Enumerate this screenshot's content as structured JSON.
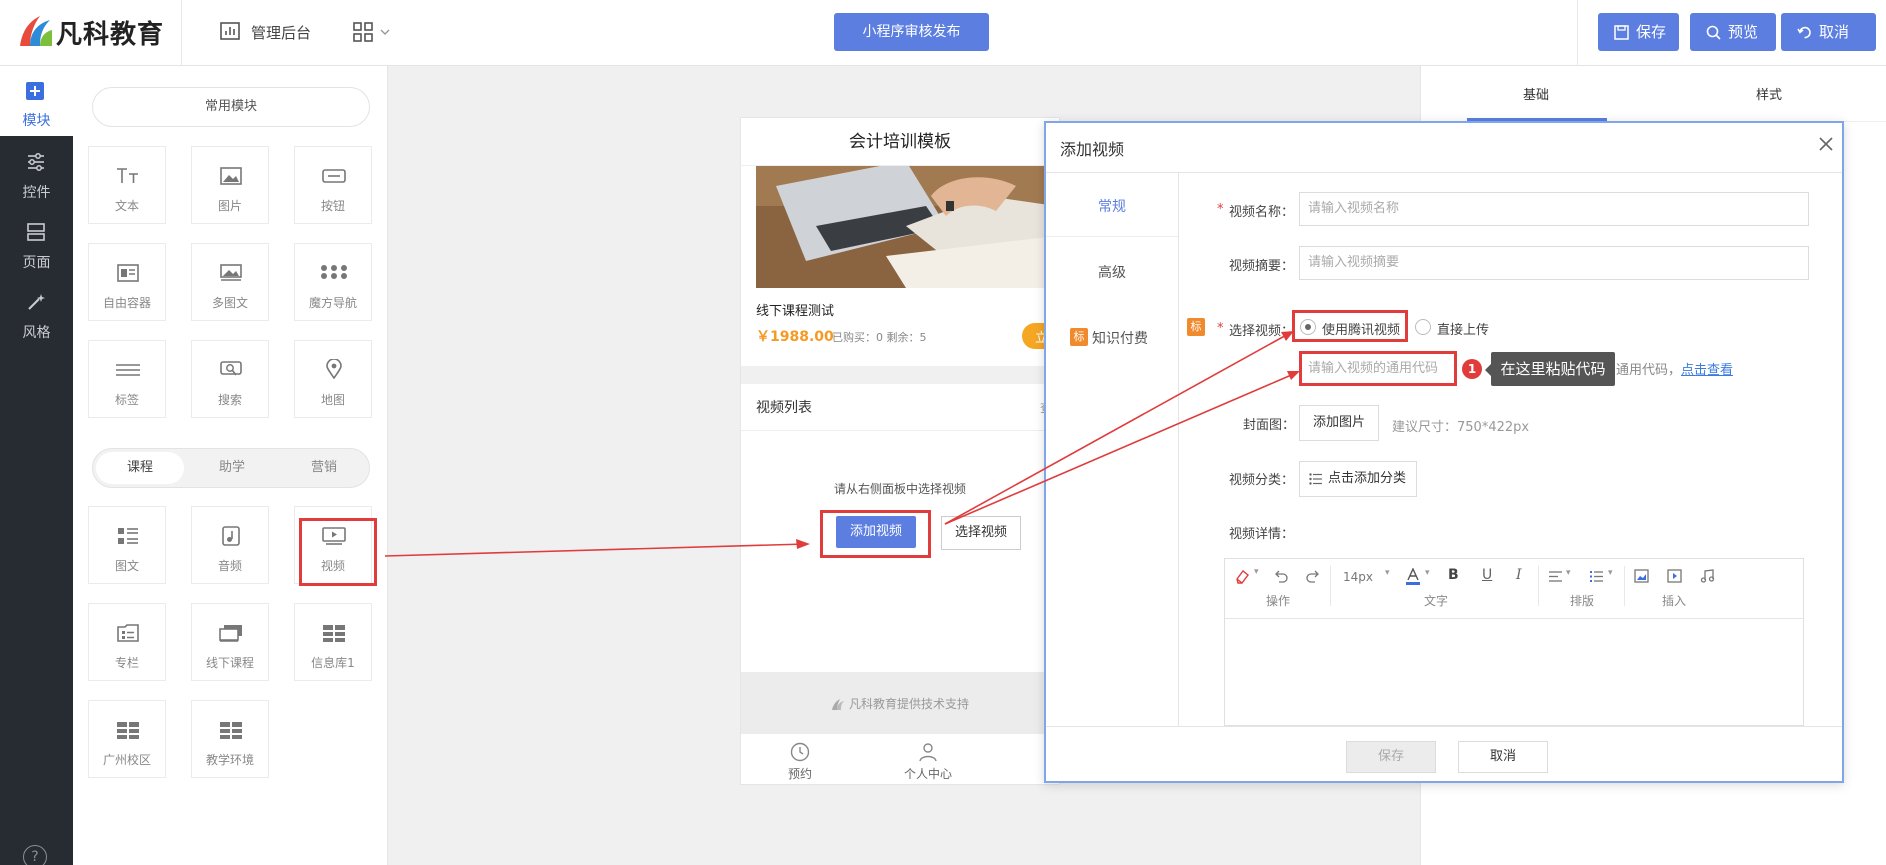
{
  "header": {
    "logo_text": "凡科教育",
    "admin_label": "管理后台",
    "publish_label": "小程序审核发布",
    "save_label": "保存",
    "preview_label": "预览",
    "cancel_label": "取消"
  },
  "rail": {
    "items": [
      {
        "label": "模块",
        "icon": "plus-square-icon"
      },
      {
        "label": "控件",
        "icon": "sliders-icon"
      },
      {
        "label": "页面",
        "icon": "pages-icon"
      },
      {
        "label": "风格",
        "icon": "magic-wand-icon"
      }
    ],
    "help": "?"
  },
  "left_panel": {
    "common_title": "常用模块",
    "common_modules": [
      "文本",
      "图片",
      "按钮",
      "自由容器",
      "多图文",
      "魔方导航",
      "标签",
      "搜索",
      "地图"
    ],
    "category_tabs": [
      "课程",
      "助学",
      "营销"
    ],
    "course_modules": [
      "图文",
      "音频",
      "视频",
      "专栏",
      "线下课程",
      "信息库1",
      "广州校区",
      "教学环境"
    ]
  },
  "phone": {
    "title": "会计培训模板",
    "course_name": "线下课程测试",
    "course_price": "￥1988.00",
    "course_meta": "已购买：0 剩余：5",
    "buy_label": "立",
    "video_list_title": "视频列表",
    "video_list_more": "查",
    "empty_hint": "请从右侧面板中选择视频",
    "add_video_label": "添加视频",
    "choose_video_label": "选择视频",
    "footer_text": "凡科教育提供技术支持",
    "tabbar": [
      "预约",
      "个人中心"
    ]
  },
  "right_panel": {
    "tabs": [
      "基础",
      "样式"
    ]
  },
  "modal": {
    "title": "添加视频",
    "side_tabs": [
      "常规",
      "高级",
      "知识付费"
    ],
    "badge": "标",
    "fields": {
      "name_label": "视频名称：",
      "name_placeholder": "请输入视频名称",
      "summary_label": "视频摘要：",
      "summary_placeholder": "请输入视频摘要",
      "select_label": "选择视频：",
      "radio_tencent": "使用腾讯视频",
      "radio_upload": "直接上传",
      "code_placeholder": "请输入视频的通用代码",
      "step_number": "1",
      "tooltip": "在这里粘贴代码",
      "code_hint": "通用代码，",
      "code_hint_link": "点击查看",
      "cover_label": "封面图：",
      "cover_button": "添加图片",
      "cover_hint": "建议尺寸：750*422px",
      "category_label": "视频分类：",
      "category_button": "点击添加分类",
      "detail_label": "视频详情："
    },
    "editor": {
      "font_size": "14px",
      "groups": [
        "操作",
        "文字",
        "排版",
        "插入"
      ]
    },
    "save_label": "保存",
    "cancel_label": "取消"
  },
  "colors": {
    "primary": "#5b7ee0",
    "highlight_red": "#e03c3c",
    "price_orange": "#f59a23",
    "badge_orange": "#f08a2c",
    "rail_dark": "#272c33"
  }
}
